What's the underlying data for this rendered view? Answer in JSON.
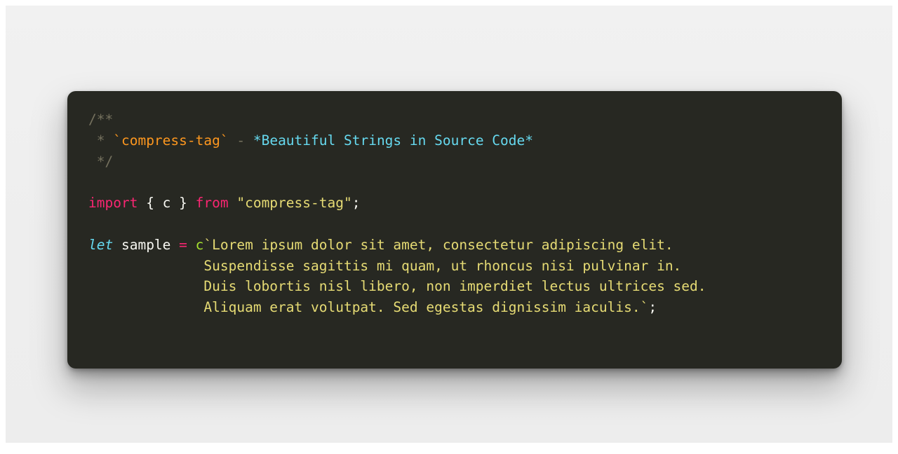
{
  "page": {
    "background_color": "#eeeeee",
    "frame_color": "#ffffff"
  },
  "code_card": {
    "background_color": "#272822",
    "corner_radius_px": 12,
    "language": "javascript",
    "theme": "monokai",
    "colors": {
      "comment": "#75715e",
      "inline_code": "#fd971f",
      "emphasis": "#66d9ef",
      "keyword": "#f92672",
      "string": "#e6db74",
      "function": "#a6e22e",
      "declaration_keyword": "#66d9ef",
      "plain": "#f8f8f2"
    },
    "lines": {
      "l1": {
        "comment_open": "/**"
      },
      "l2": {
        "star": " * ",
        "inline_code": "`compress-tag`",
        "dash": " - ",
        "emphasis": "*Beautiful Strings in Source Code*"
      },
      "l3": {
        "comment_close": " */"
      },
      "l4": {
        "blank": ""
      },
      "l5": {
        "import_keyword": "import",
        "braces": " { c } ",
        "from_keyword": "from",
        "module_string": " \"compress-tag\"",
        "semicolon": ";"
      },
      "l6": {
        "blank": ""
      },
      "l7": {
        "declaration": "let",
        "variable": " sample ",
        "assign": "=",
        "tag_function": " c",
        "backtick_open": "`",
        "string_text": "Lorem ipsum dolor sit amet, consectetur adipiscing elit."
      },
      "l8": {
        "indent": "              ",
        "string_text": "Suspendisse sagittis mi quam, ut rhoncus nisi pulvinar in."
      },
      "l9": {
        "indent": "              ",
        "string_text": "Duis lobortis nisl libero, non imperdiet lectus ultrices sed."
      },
      "l10": {
        "indent": "              ",
        "string_text": "Aliquam erat volutpat. Sed egestas dignissim iaculis.",
        "backtick_close": "`",
        "semicolon": ";"
      }
    }
  }
}
